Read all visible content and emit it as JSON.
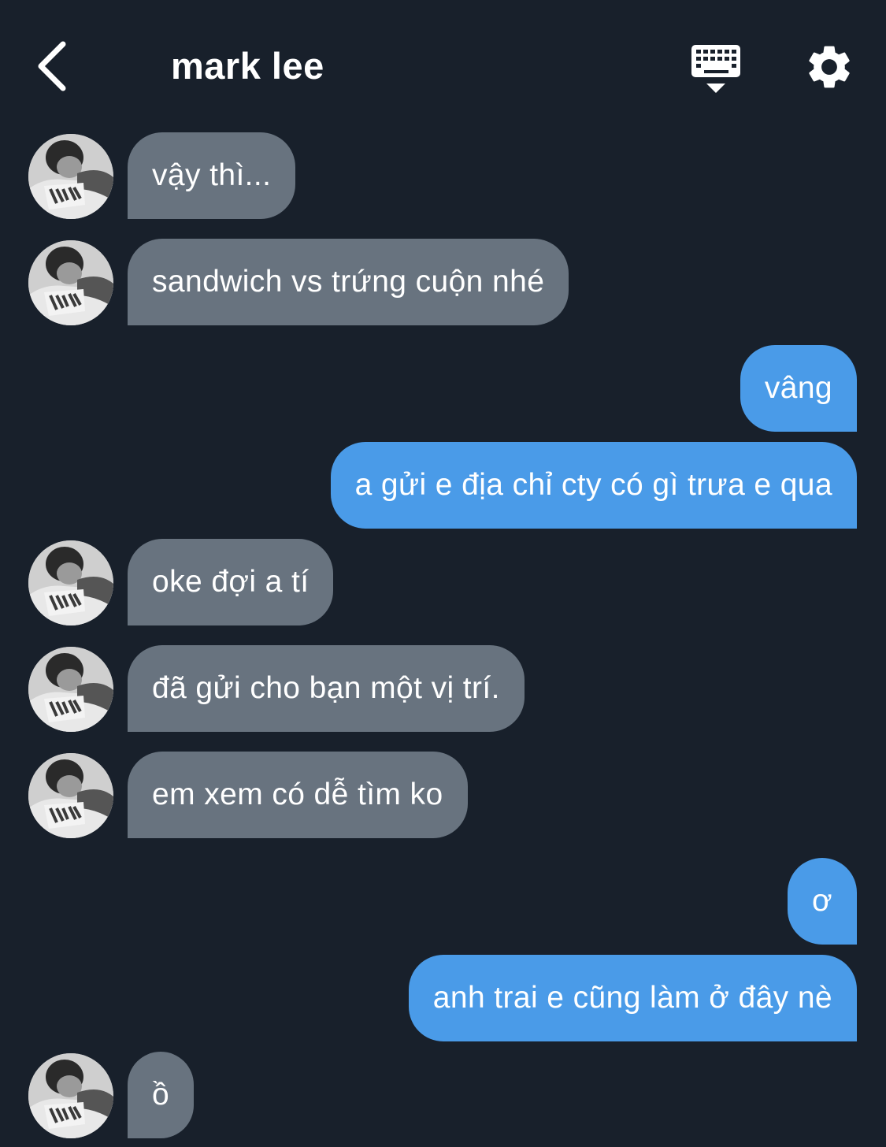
{
  "header": {
    "back_icon": "chevron-left-icon",
    "title": "mark lee",
    "keyboard_icon": "keyboard-icon",
    "settings_icon": "gear-icon"
  },
  "colors": {
    "background": "#18202b",
    "incoming_bubble": "#68737f",
    "outgoing_bubble": "#4a9be8",
    "text": "#ffffff"
  },
  "messages": [
    {
      "sender": "mark lee",
      "direction": "incoming",
      "text": "vậy thì..."
    },
    {
      "sender": "mark lee",
      "direction": "incoming",
      "text": "sandwich vs trứng cuộn nhé"
    },
    {
      "sender": "me",
      "direction": "outgoing",
      "text": "vâng"
    },
    {
      "sender": "me",
      "direction": "outgoing",
      "text": "a gửi e địa chỉ cty có gì trưa e qua"
    },
    {
      "sender": "mark lee",
      "direction": "incoming",
      "text": "oke đợi a tí"
    },
    {
      "sender": "mark lee",
      "direction": "incoming",
      "text": "đã gửi cho bạn một vị trí."
    },
    {
      "sender": "mark lee",
      "direction": "incoming",
      "text": "em xem có dễ tìm ko"
    },
    {
      "sender": "me",
      "direction": "outgoing",
      "text": "ơ"
    },
    {
      "sender": "me",
      "direction": "outgoing",
      "text": "anh trai e cũng làm ở đây nè"
    },
    {
      "sender": "mark lee",
      "direction": "incoming",
      "text": "ồ"
    }
  ]
}
